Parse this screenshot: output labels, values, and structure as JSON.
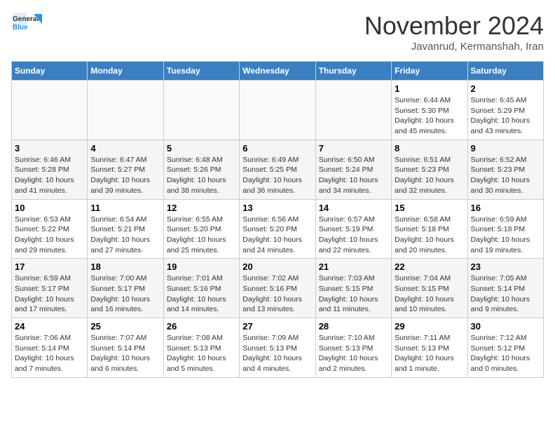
{
  "header": {
    "logo_general": "General",
    "logo_blue": "Blue",
    "month_title": "November 2024",
    "location": "Javanrud, Kermanshah, Iran"
  },
  "days_of_week": [
    "Sunday",
    "Monday",
    "Tuesday",
    "Wednesday",
    "Thursday",
    "Friday",
    "Saturday"
  ],
  "weeks": [
    [
      {
        "num": "",
        "info": ""
      },
      {
        "num": "",
        "info": ""
      },
      {
        "num": "",
        "info": ""
      },
      {
        "num": "",
        "info": ""
      },
      {
        "num": "",
        "info": ""
      },
      {
        "num": "1",
        "info": "Sunrise: 6:44 AM\nSunset: 5:30 PM\nDaylight: 10 hours and 45 minutes."
      },
      {
        "num": "2",
        "info": "Sunrise: 6:45 AM\nSunset: 5:29 PM\nDaylight: 10 hours and 43 minutes."
      }
    ],
    [
      {
        "num": "3",
        "info": "Sunrise: 6:46 AM\nSunset: 5:28 PM\nDaylight: 10 hours and 41 minutes."
      },
      {
        "num": "4",
        "info": "Sunrise: 6:47 AM\nSunset: 5:27 PM\nDaylight: 10 hours and 39 minutes."
      },
      {
        "num": "5",
        "info": "Sunrise: 6:48 AM\nSunset: 5:26 PM\nDaylight: 10 hours and 38 minutes."
      },
      {
        "num": "6",
        "info": "Sunrise: 6:49 AM\nSunset: 5:25 PM\nDaylight: 10 hours and 36 minutes."
      },
      {
        "num": "7",
        "info": "Sunrise: 6:50 AM\nSunset: 5:24 PM\nDaylight: 10 hours and 34 minutes."
      },
      {
        "num": "8",
        "info": "Sunrise: 6:51 AM\nSunset: 5:23 PM\nDaylight: 10 hours and 32 minutes."
      },
      {
        "num": "9",
        "info": "Sunrise: 6:52 AM\nSunset: 5:23 PM\nDaylight: 10 hours and 30 minutes."
      }
    ],
    [
      {
        "num": "10",
        "info": "Sunrise: 6:53 AM\nSunset: 5:22 PM\nDaylight: 10 hours and 29 minutes."
      },
      {
        "num": "11",
        "info": "Sunrise: 6:54 AM\nSunset: 5:21 PM\nDaylight: 10 hours and 27 minutes."
      },
      {
        "num": "12",
        "info": "Sunrise: 6:55 AM\nSunset: 5:20 PM\nDaylight: 10 hours and 25 minutes."
      },
      {
        "num": "13",
        "info": "Sunrise: 6:56 AM\nSunset: 5:20 PM\nDaylight: 10 hours and 24 minutes."
      },
      {
        "num": "14",
        "info": "Sunrise: 6:57 AM\nSunset: 5:19 PM\nDaylight: 10 hours and 22 minutes."
      },
      {
        "num": "15",
        "info": "Sunrise: 6:58 AM\nSunset: 5:18 PM\nDaylight: 10 hours and 20 minutes."
      },
      {
        "num": "16",
        "info": "Sunrise: 6:59 AM\nSunset: 5:18 PM\nDaylight: 10 hours and 19 minutes."
      }
    ],
    [
      {
        "num": "17",
        "info": "Sunrise: 6:59 AM\nSunset: 5:17 PM\nDaylight: 10 hours and 17 minutes."
      },
      {
        "num": "18",
        "info": "Sunrise: 7:00 AM\nSunset: 5:17 PM\nDaylight: 10 hours and 16 minutes."
      },
      {
        "num": "19",
        "info": "Sunrise: 7:01 AM\nSunset: 5:16 PM\nDaylight: 10 hours and 14 minutes."
      },
      {
        "num": "20",
        "info": "Sunrise: 7:02 AM\nSunset: 5:16 PM\nDaylight: 10 hours and 13 minutes."
      },
      {
        "num": "21",
        "info": "Sunrise: 7:03 AM\nSunset: 5:15 PM\nDaylight: 10 hours and 11 minutes."
      },
      {
        "num": "22",
        "info": "Sunrise: 7:04 AM\nSunset: 5:15 PM\nDaylight: 10 hours and 10 minutes."
      },
      {
        "num": "23",
        "info": "Sunrise: 7:05 AM\nSunset: 5:14 PM\nDaylight: 10 hours and 9 minutes."
      }
    ],
    [
      {
        "num": "24",
        "info": "Sunrise: 7:06 AM\nSunset: 5:14 PM\nDaylight: 10 hours and 7 minutes."
      },
      {
        "num": "25",
        "info": "Sunrise: 7:07 AM\nSunset: 5:14 PM\nDaylight: 10 hours and 6 minutes."
      },
      {
        "num": "26",
        "info": "Sunrise: 7:08 AM\nSunset: 5:13 PM\nDaylight: 10 hours and 5 minutes."
      },
      {
        "num": "27",
        "info": "Sunrise: 7:09 AM\nSunset: 5:13 PM\nDaylight: 10 hours and 4 minutes."
      },
      {
        "num": "28",
        "info": "Sunrise: 7:10 AM\nSunset: 5:13 PM\nDaylight: 10 hours and 2 minutes."
      },
      {
        "num": "29",
        "info": "Sunrise: 7:11 AM\nSunset: 5:13 PM\nDaylight: 10 hours and 1 minute."
      },
      {
        "num": "30",
        "info": "Sunrise: 7:12 AM\nSunset: 5:12 PM\nDaylight: 10 hours and 0 minutes."
      }
    ]
  ]
}
